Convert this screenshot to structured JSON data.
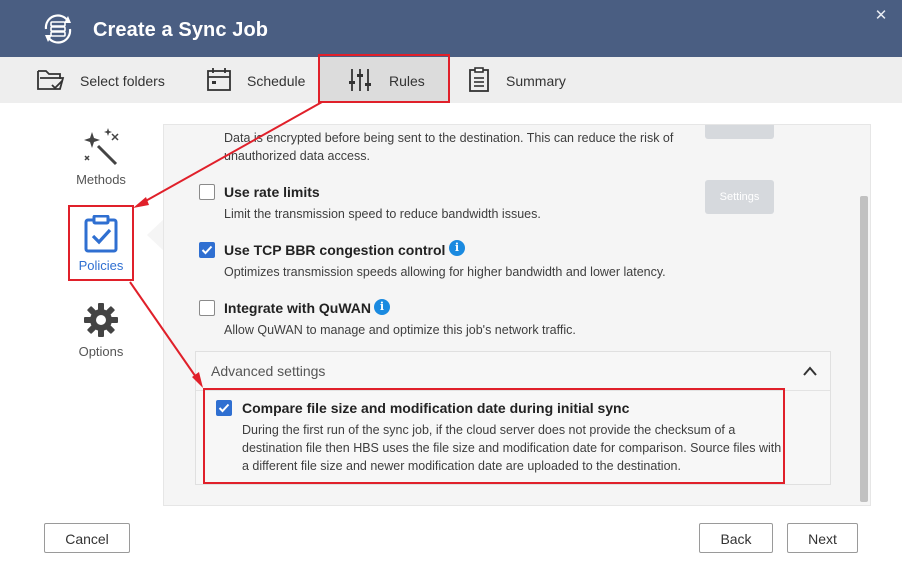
{
  "window": {
    "title": "Create a Sync Job",
    "close_glyph": "✕"
  },
  "tabs": [
    {
      "label": "Select folders",
      "icon": "folder-check-icon"
    },
    {
      "label": "Schedule",
      "icon": "calendar-icon"
    },
    {
      "label": "Rules",
      "icon": "sliders-icon",
      "active": true
    },
    {
      "label": "Summary",
      "icon": "clipboard-list-icon"
    }
  ],
  "sidenav": [
    {
      "label": "Methods",
      "icon": "magic-wand-icon"
    },
    {
      "label": "Policies",
      "icon": "clipboard-check-icon",
      "active": true
    },
    {
      "label": "Options",
      "icon": "gear-icon"
    }
  ],
  "rules": {
    "encrypt": {
      "description": "Data is encrypted before being sent to the destination. This can reduce the risk of unauthorized data access."
    },
    "rate_limits": {
      "title": "Use rate limits",
      "description": "Limit the transmission speed to reduce bandwidth issues.",
      "checked": false,
      "settings_label": "Settings"
    },
    "tcp_bbr": {
      "title": "Use TCP BBR congestion control",
      "description": "Optimizes transmission speeds allowing for higher bandwidth and lower latency.",
      "checked": true
    },
    "quwan": {
      "title": "Integrate with QuWAN",
      "description": "Allow QuWAN to manage and optimize this job's network traffic.",
      "checked": false
    }
  },
  "advanced": {
    "title": "Advanced settings",
    "expanded": true,
    "compare": {
      "title": "Compare file size and modification date during initial sync",
      "description": "During the first run of the sync job, if the cloud server does not provide the checksum of a destination file then HBS uses the file size and modification date for comparison. Source files with a different file size and newer modification date are uploaded to the destination.",
      "checked": true
    }
  },
  "footer": {
    "cancel": "Cancel",
    "back": "Back",
    "next": "Next"
  },
  "colors": {
    "titlebar": "#4a5e82",
    "accent": "#2f6fd1",
    "highlight": "#e0202a",
    "info": "#1a8ae0"
  }
}
